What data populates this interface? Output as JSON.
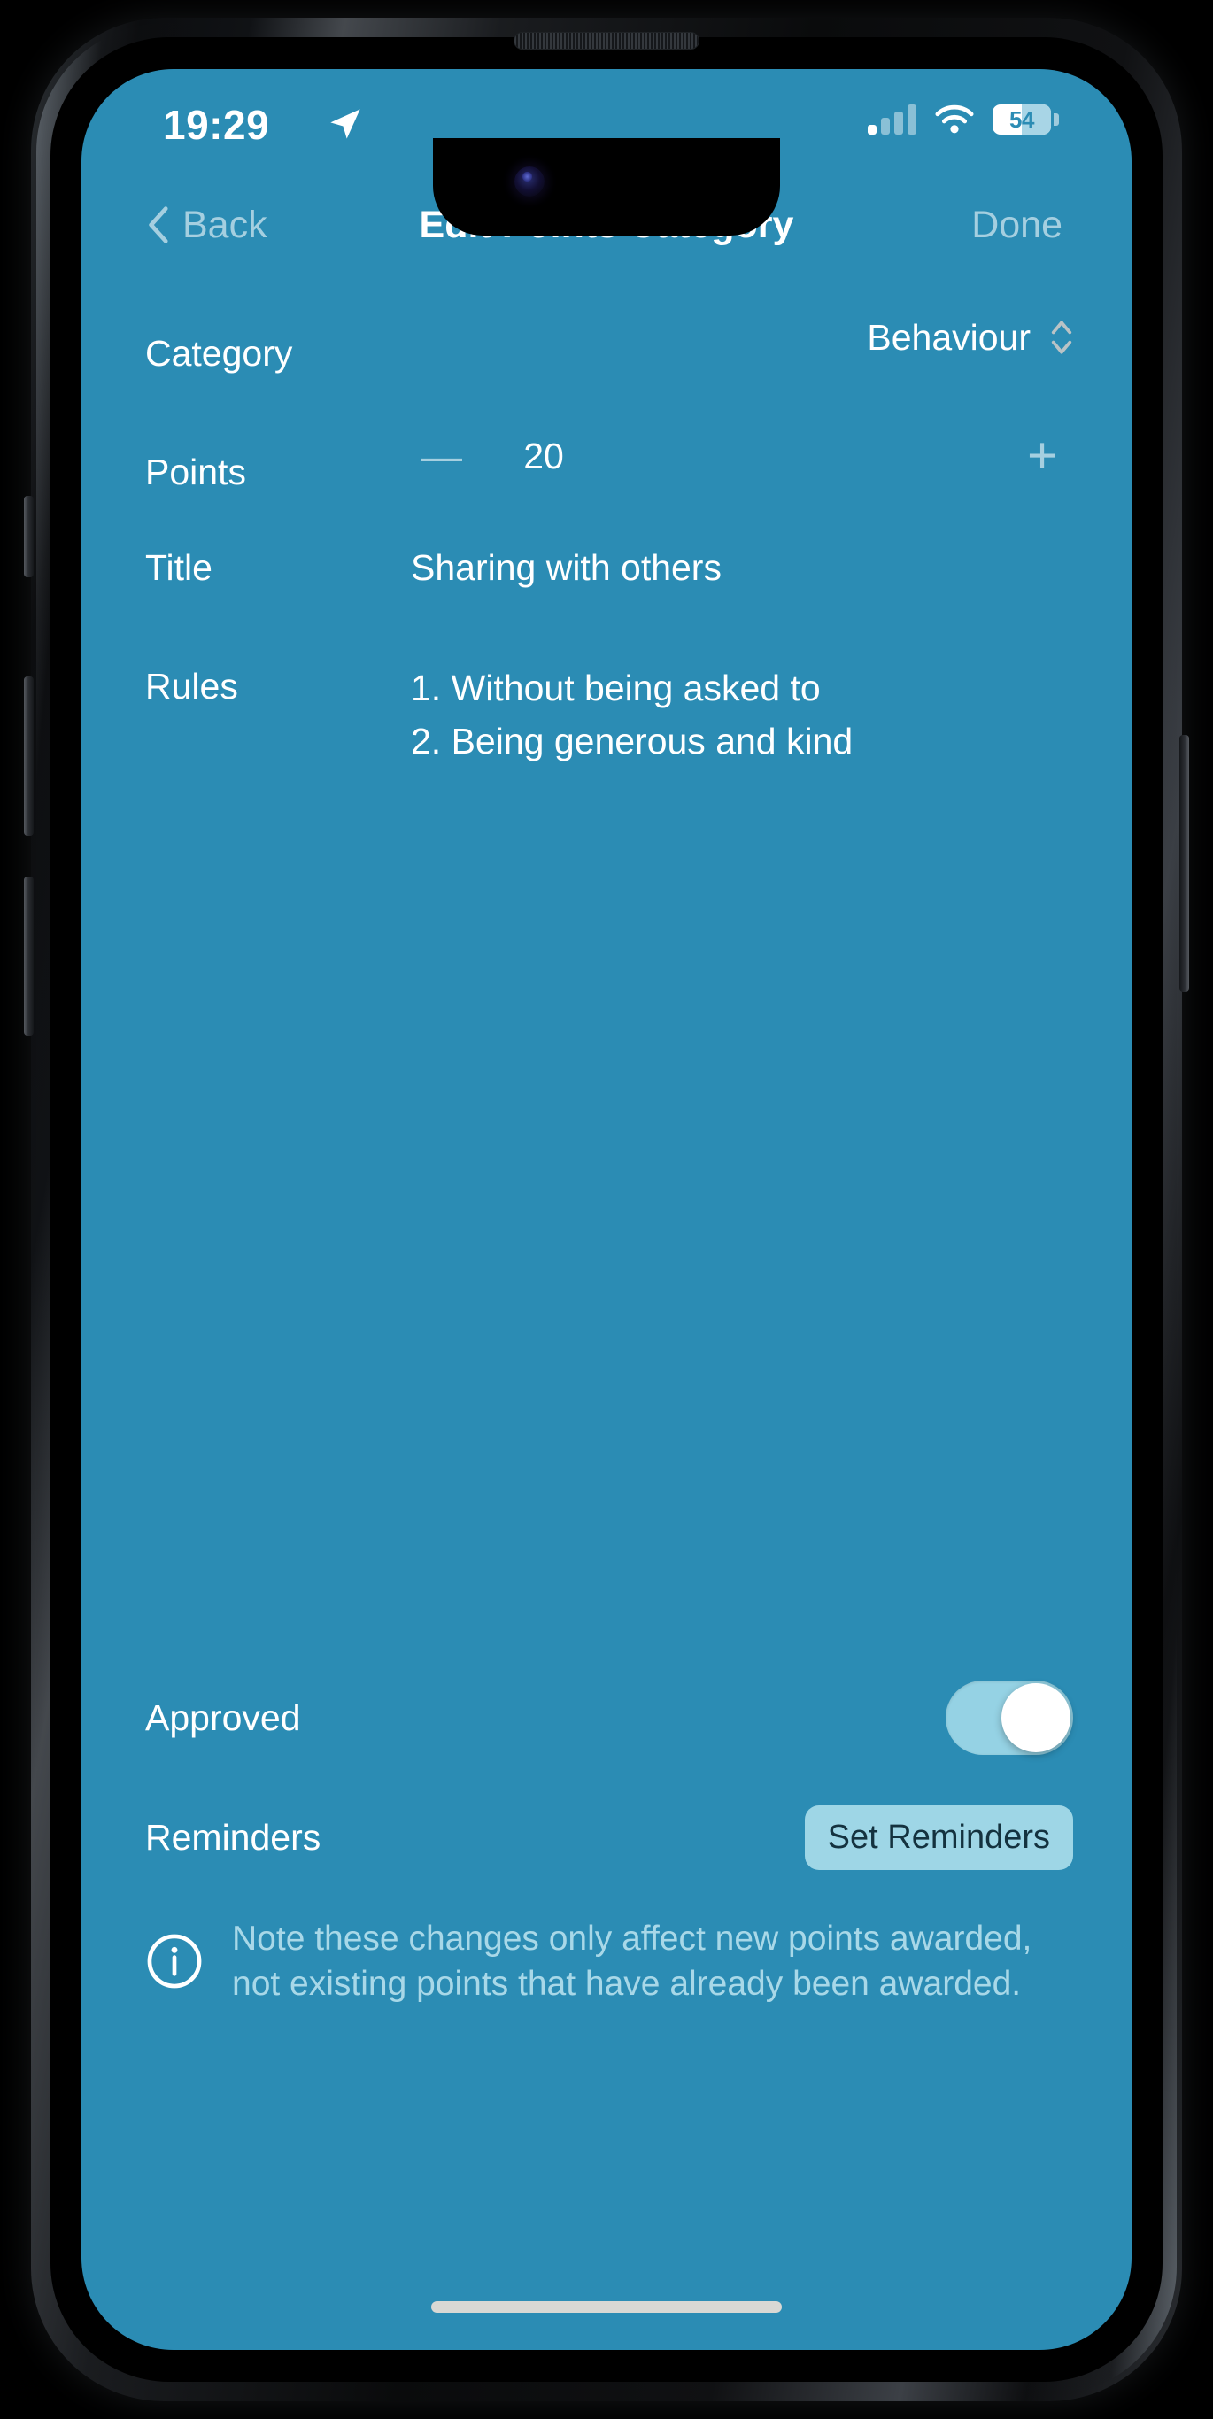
{
  "status_bar": {
    "time": "19:29",
    "location_icon": "location-arrow-icon",
    "signal_icon": "cellular-signal-icon",
    "wifi_icon": "wifi-icon",
    "battery_percent": "54",
    "battery_icon": "battery-icon"
  },
  "nav": {
    "back_label": "Back",
    "back_icon": "chevron-left-icon",
    "title": "Edit Points Category",
    "done_label": "Done"
  },
  "form": {
    "category": {
      "label": "Category",
      "value": "Behaviour",
      "picker_icon": "chevron-up-down-icon"
    },
    "points": {
      "label": "Points",
      "value": "20",
      "minus_label": "—",
      "plus_label": "+"
    },
    "title": {
      "label": "Title",
      "value": "Sharing with others"
    },
    "rules": {
      "label": "Rules",
      "items": [
        "1. Without being asked to",
        "2. Being generous and kind"
      ]
    }
  },
  "settings": {
    "approved": {
      "label": "Approved",
      "state": "on"
    },
    "reminders": {
      "label": "Reminders",
      "button_label": "Set Reminders"
    }
  },
  "note": {
    "icon": "info-circle-icon",
    "text": "Note these changes only affect new points awarded, not existing points that have already been awarded."
  },
  "colors": {
    "screen_background": "#2b8cb4",
    "accent_light": "#a5cfe0",
    "toggle_on_track": "#95d2e4",
    "button_background": "#9ed6e6",
    "note_text": "#a8d8e8",
    "primary_text": "#ffffff"
  }
}
